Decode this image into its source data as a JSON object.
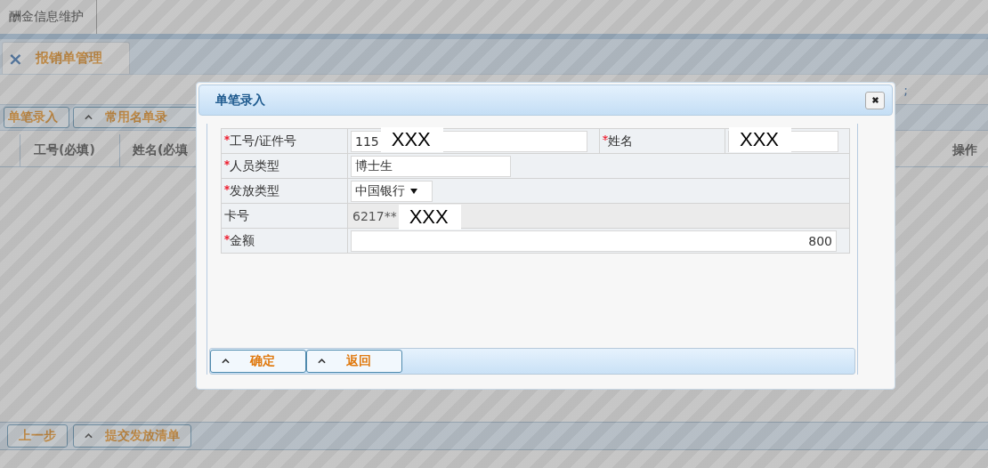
{
  "page": {
    "top_tab": "酬金信息维护",
    "tab": {
      "close": "×",
      "label": "报销单管理",
      "selected": true
    },
    "toolbar_mark": ";",
    "buttons": [
      {
        "label": "单笔录入",
        "caret": false
      },
      {
        "label": "常用名单录",
        "caret": true
      }
    ],
    "columns": [
      "工号(必填)",
      "姓名(必填",
      "操作"
    ],
    "bottom_buttons": [
      {
        "label": "上一步",
        "caret": false
      },
      {
        "label": "提交发放清单",
        "caret": true
      }
    ]
  },
  "dialog": {
    "title": "单笔录入",
    "rows": [
      {
        "kind": "pair",
        "fields": [
          {
            "label": "工号/证件号",
            "required": true,
            "value": "115",
            "redaction": "XXX"
          },
          {
            "label": "姓名",
            "required": true,
            "redaction": "XXX"
          }
        ]
      },
      {
        "kind": "text",
        "label": "人员类型",
        "required": true,
        "value": "博士生"
      },
      {
        "kind": "select",
        "label": "发放类型",
        "required": true,
        "value": "中国银行"
      },
      {
        "kind": "readonly",
        "label": "卡号",
        "required": false,
        "value": "6217**",
        "redaction": "XXX"
      },
      {
        "kind": "amount",
        "label": "金额",
        "required": true,
        "value": "800"
      }
    ],
    "buttons": [
      {
        "label": "确定",
        "caret": true
      },
      {
        "label": "返回",
        "caret": true
      }
    ]
  }
}
